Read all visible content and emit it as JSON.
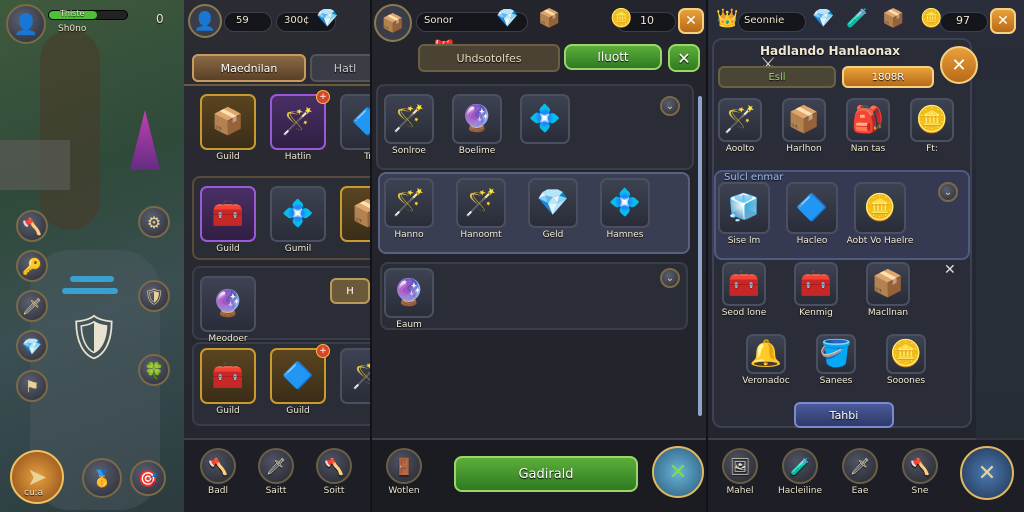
{
  "p1": {
    "player": {
      "name": "Thiste",
      "level": "0",
      "subtitle": "Sh0no"
    },
    "hp_percent": 0.62,
    "bottom": {
      "main_label": "cu:a",
      "items": [
        "🥇",
        "🎯"
      ]
    },
    "side_left": [
      "🪓",
      "🔑",
      "🗡",
      "💎",
      "⚑"
    ],
    "side_right": [
      "⚙",
      "🛡",
      "🍀"
    ],
    "hud_label": "H"
  },
  "p2": {
    "currency": [
      {
        "value": "59"
      },
      {
        "value": "300¢"
      }
    ],
    "tabs": [
      "Maednilan",
      "Hatl"
    ],
    "rows": [
      [
        {
          "label": "Guild",
          "icon": "📦",
          "style": "gold"
        },
        {
          "label": "Hatlin",
          "icon": "🪄",
          "style": "purple",
          "badge": "+"
        },
        {
          "label": "Tr",
          "icon": "🔷",
          "style": ""
        }
      ],
      [
        {
          "label": "Guild",
          "icon": "🧰",
          "style": "purple"
        },
        {
          "label": "Gumil",
          "icon": "💠",
          "style": ""
        },
        {
          "label": "",
          "icon": "📦",
          "style": "gold"
        }
      ],
      [
        {
          "label": "Meodoer",
          "icon": "🔮",
          "style": ""
        }
      ],
      [
        {
          "label": "Guild",
          "icon": "🧰",
          "style": "gold"
        },
        {
          "label": "Guild",
          "icon": "🔷",
          "style": "gold",
          "badge": "+"
        },
        {
          "label": "",
          "icon": "🪄",
          "style": ""
        }
      ]
    ],
    "nav": [
      {
        "label": "Badl",
        "icon": "🪓"
      },
      {
        "label": "Saitt",
        "icon": "🗡"
      },
      {
        "label": "Soitt",
        "icon": "🪓"
      }
    ]
  },
  "p3": {
    "top_value": "Sonor",
    "gold_value": "10",
    "header_tab": "Uhdsotolfes",
    "header_btn": "Iluott",
    "rows": [
      [
        {
          "label": "Sonlroe",
          "icon": "🪄"
        },
        {
          "label": "Boelime",
          "icon": "🔮"
        },
        {
          "label": "",
          "icon": "💠"
        }
      ],
      [
        {
          "label": "Hanno",
          "icon": "🪄"
        },
        {
          "label": "Hanoomt",
          "icon": "🪄"
        },
        {
          "label": "Geld",
          "icon": "💎"
        },
        {
          "label": "Hamnes",
          "icon": "💠"
        }
      ],
      [
        {
          "label": "Eaum",
          "icon": "🔮"
        }
      ]
    ],
    "action_btn": "Gadirald",
    "nav": [
      {
        "label": "Wotlen",
        "icon": "🚪"
      }
    ]
  },
  "p4": {
    "top_value": "Seonnie",
    "gold_value": "97",
    "title": "Hadlando Hanlaonax",
    "pill1": "Esll",
    "pill2": "1808R",
    "row1": [
      {
        "label": "Aoolto",
        "icon": "🪄"
      },
      {
        "label": "Harlhon",
        "icon": "📦"
      },
      {
        "label": "Nan tas",
        "icon": "🎒"
      },
      {
        "label": "Ft:",
        "icon": "🪙"
      }
    ],
    "section_title": "Sulcl enmar",
    "row2": [
      {
        "label": "Sise lm",
        "icon": "🧊"
      },
      {
        "label": "Hacleo",
        "icon": "🔷"
      },
      {
        "label": "Aobt Vo Haelre",
        "icon": "🪙"
      }
    ],
    "row3": [
      {
        "label": "Seod lone",
        "icon": "🧰"
      },
      {
        "label": "Kenmig",
        "icon": "🧰"
      },
      {
        "label": "Macllnan",
        "icon": "📦"
      }
    ],
    "row4": [
      {
        "label": "Veronadoc",
        "icon": "🔔"
      },
      {
        "label": "Sanees",
        "icon": "🪣"
      },
      {
        "label": "Sooones",
        "icon": "🪙"
      }
    ],
    "bottom_tab": "Tahbi",
    "nav": [
      {
        "label": "Mahel",
        "icon": "🖼"
      },
      {
        "label": "Hacleiline",
        "icon": "🧪"
      },
      {
        "label": "Eae",
        "icon": "🗡"
      },
      {
        "label": "Sne",
        "icon": "🪓"
      }
    ]
  }
}
